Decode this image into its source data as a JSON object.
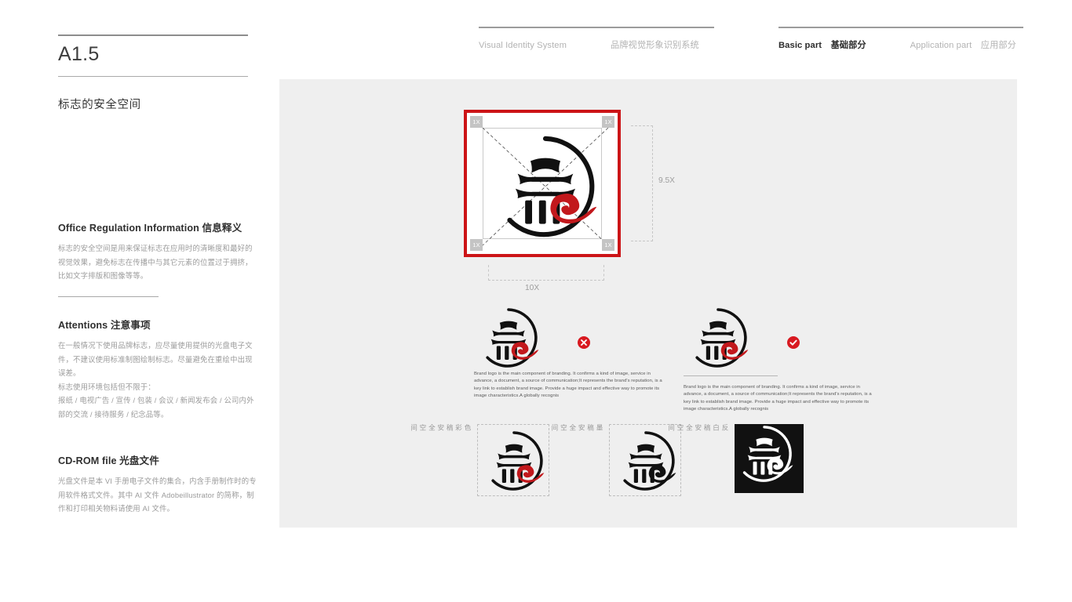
{
  "page": {
    "code": "A1.5",
    "subtitle": "标志的安全空间"
  },
  "nav": {
    "left": {
      "en": "Visual Identity System",
      "cn": "品牌视觉形象识别系统"
    },
    "right": {
      "basic_en": "Basic part",
      "basic_cn": "基础部分",
      "app_en": "Application part",
      "app_cn": "应用部分"
    }
  },
  "sections": {
    "office": {
      "heading_en": "Office Regulation Information",
      "heading_cn": "信息释义",
      "body": "标志的安全空间是用来保证标志在应用时的清晰度和最好的视觉效果，避免标志在传播中与其它元素的位置过于拥挤，比如文字排版和图像等等。"
    },
    "attentions": {
      "heading_en": "Attentions",
      "heading_cn": "注意事项",
      "body_1": "在一般情况下使用品牌标志，应尽量使用提供的光盘电子文件，不建议使用标准制图绘制标志。尽量避免在重绘中出现误差。",
      "body_2": "标志使用环境包括但不限于：",
      "body_3": "报纸 / 电视广告 / 宣传 / 包装 / 会议 / 新闻发布会 / 公司内外部的交流 / 接待服务 / 纪念品等。"
    },
    "cdrom": {
      "heading_en": "CD-ROM file",
      "heading_cn": "光盘文件",
      "body": "光盘文件是本 VI 手册电子文件的集合，内含手册制作时的专用软件格式文件。其中 AI 文件 Adobeillustrator 的简称，制作和打印相关物料请使用 AI 文件。"
    }
  },
  "diagram": {
    "corner_labels": {
      "tl": "1X",
      "tr": "1X",
      "bl": "1X",
      "br": "1X"
    },
    "height_label": "9.5X",
    "width_label": "10X"
  },
  "examples": {
    "bad": {
      "mark": "cross-icon",
      "text": "Brand logo is the main component of branding. It confirms a kind of image, service in advance, a document, a source of communication;It represents the brand's reputation, is a key link to establish brand image. Provide a huge impact and effective way to promote its image characteristics.A globally recognis"
    },
    "good": {
      "mark": "check-icon",
      "text": "Brand logo is the main component of branding. It confirms a kind of image, service in advance, a document, a source of communication;It represents the brand's reputation, is a key link to establish brand image. Provide a huge impact and effective way to promote its image characteristics.A globally recognis"
    }
  },
  "variants": [
    {
      "label": "色彩稿安全空间",
      "name": "color"
    },
    {
      "label": "墨稿安全空间",
      "name": "mono"
    },
    {
      "label": "反白稿安全空间",
      "name": "reversed"
    }
  ],
  "colors": {
    "brand_red": "#cc1417",
    "swirl_red": "#c2181c",
    "canvas_bg": "#efefef",
    "corner_gray": "#c4c4c4"
  }
}
